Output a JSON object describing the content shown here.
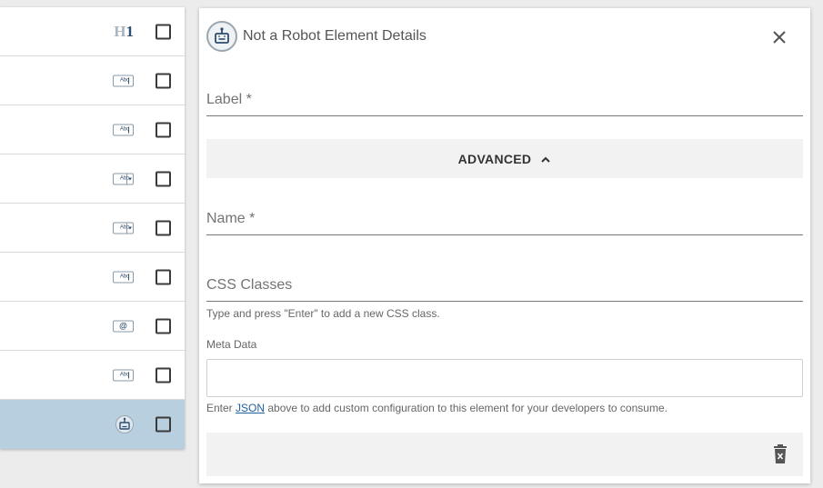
{
  "list": {
    "items": [
      {
        "icon": "heading-h1-icon",
        "icon_text_h": "H",
        "icon_text_1": "1",
        "checked": false,
        "selected": false
      },
      {
        "icon": "text-field-icon",
        "icon_text": "Abc",
        "checked": false,
        "selected": false
      },
      {
        "icon": "text-field-icon",
        "icon_text": "Abc",
        "checked": false,
        "selected": false
      },
      {
        "icon": "dropdown-field-icon",
        "icon_text": "Abc",
        "checked": false,
        "selected": false
      },
      {
        "icon": "dropdown-field-icon",
        "icon_text": "Abc",
        "checked": false,
        "selected": false
      },
      {
        "icon": "text-field-icon",
        "icon_text": "Abc",
        "checked": false,
        "selected": false
      },
      {
        "icon": "email-field-icon",
        "icon_text": "@",
        "checked": false,
        "selected": false
      },
      {
        "icon": "text-field-icon",
        "icon_text": "Abc",
        "checked": false,
        "selected": false
      },
      {
        "icon": "robot-icon",
        "checked": false,
        "selected": true
      }
    ],
    "selected_color": "#b8cfe0"
  },
  "panel": {
    "title": "Not a Robot Element Details",
    "icon": "robot-icon",
    "close_icon": "close-icon",
    "label_field": {
      "placeholder": "Label *",
      "value": ""
    },
    "advanced_label": "ADVANCED",
    "advanced_icon": "chevron-up-icon",
    "name_field": {
      "placeholder": "Name *",
      "value": ""
    },
    "css_field": {
      "placeholder": "CSS Classes",
      "value": ""
    },
    "css_helper": "Type and press \"Enter\" to add a new CSS class.",
    "meta_label": "Meta Data",
    "meta_value": "",
    "meta_help_prefix": "Enter ",
    "meta_help_link": "JSON",
    "meta_help_suffix": " above to add custom configuration to this element for your developers to consume.",
    "delete_icon": "trash-icon"
  },
  "colors": {
    "accent": "#1f5fa0",
    "panel_bg": "#ffffff",
    "page_bg": "#ececec"
  }
}
